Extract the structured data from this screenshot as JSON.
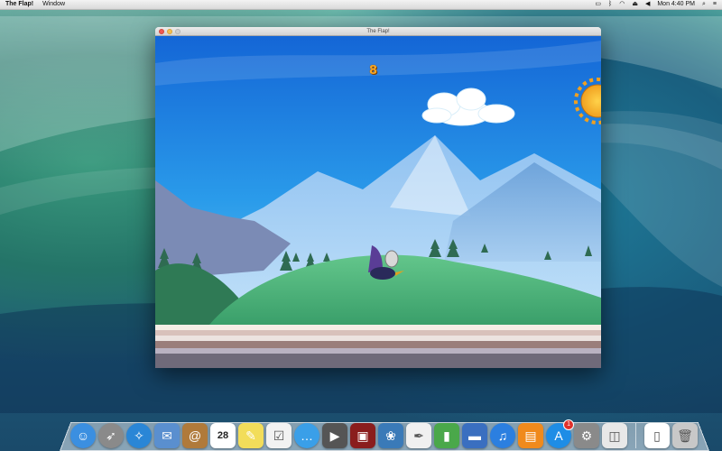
{
  "menubar": {
    "app_name": "The Flap!",
    "menus": [
      "Window"
    ],
    "clock": "Mon 4:40 PM",
    "status_icons": [
      "airplay-icon",
      "bluetooth-icon",
      "wifi-icon",
      "eject-icon",
      "volume-icon",
      "search-icon",
      "menu-list-icon"
    ]
  },
  "window": {
    "title": "The Flap!"
  },
  "game": {
    "score": "8"
  },
  "dock": {
    "apps": [
      {
        "name": "finder",
        "icon": "finder-icon",
        "color": "#3b8fe0"
      },
      {
        "name": "launchpad",
        "icon": "rocket-icon",
        "color": "#8a8a8a"
      },
      {
        "name": "safari",
        "icon": "compass-icon",
        "color": "#2a86d6"
      },
      {
        "name": "mail",
        "icon": "stamp-icon",
        "color": "#5a8fcf"
      },
      {
        "name": "contacts",
        "icon": "address-book-icon",
        "color": "#b07a3a"
      },
      {
        "name": "calendar",
        "icon": "calendar-icon",
        "color": "#ffffff",
        "label": "28"
      },
      {
        "name": "notes",
        "icon": "notes-icon",
        "color": "#f2dd5a"
      },
      {
        "name": "reminders",
        "icon": "reminders-icon",
        "color": "#f2f2f2"
      },
      {
        "name": "messages",
        "icon": "chat-bubbles-icon",
        "color": "#3a9fe8"
      },
      {
        "name": "facetime",
        "icon": "camera-icon",
        "color": "#555555"
      },
      {
        "name": "photo-booth",
        "icon": "photo-booth-icon",
        "color": "#8a1d1d"
      },
      {
        "name": "iphoto",
        "icon": "photos-icon",
        "color": "#3a7ab8"
      },
      {
        "name": "keynote-pages",
        "icon": "pen-icon",
        "color": "#f0f0f0"
      },
      {
        "name": "numbers",
        "icon": "bar-chart-icon",
        "color": "#4aa84a"
      },
      {
        "name": "keynote",
        "icon": "lectern-icon",
        "color": "#3a6fc0"
      },
      {
        "name": "itunes",
        "icon": "music-note-icon",
        "color": "#2b7fe0"
      },
      {
        "name": "ibooks",
        "icon": "book-icon",
        "color": "#f08a1c"
      },
      {
        "name": "app-store",
        "icon": "app-store-icon",
        "color": "#1e8de6",
        "badge": "1"
      },
      {
        "name": "system-preferences",
        "icon": "gear-icon",
        "color": "#8a8a8a"
      },
      {
        "name": "preview",
        "icon": "preview-icon",
        "color": "#e8e8e8"
      },
      {
        "name": "document",
        "icon": "document-icon",
        "color": "#ffffff"
      },
      {
        "name": "trash",
        "icon": "trash-icon",
        "color": "#c8c8c8"
      }
    ]
  }
}
